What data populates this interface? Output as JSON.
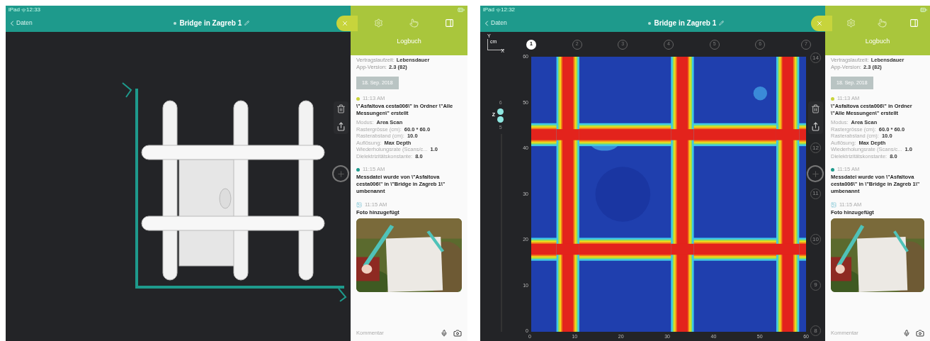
{
  "screens": [
    {
      "kind": "model-3d",
      "status_bar": {
        "carrier": "iPad",
        "time": "12:33"
      },
      "nav": {
        "back": "Daten",
        "title": "Bridge in Zagreb 1"
      },
      "logbook": {
        "header": "Logbuch",
        "info": [
          {
            "label": "Vertragslaufzeit:",
            "value": "Lebensdauer"
          },
          {
            "label": "App-Version:",
            "value": "2.3 (82)"
          }
        ],
        "date": "18. Sep. 2018",
        "entries": [
          {
            "kind": "event",
            "color": "#c9d43a",
            "time": "11:13 AM",
            "title": "\\\"Asfaltova cesta006\\\" in Ordner \\\"Alle Messungen\\\" erstellt",
            "details": [
              {
                "label": "Modus:",
                "value": "Area Scan"
              },
              {
                "label": "Rastergrösse (cm):",
                "value": "60.0 * 60.0"
              },
              {
                "label": "Rasterabstand (cm):",
                "value": "10.0"
              },
              {
                "label": "Auflösung:",
                "value": "Max Depth"
              },
              {
                "label": "Wiederholungsrate (Scans/c...",
                "value": "1.0"
              },
              {
                "label": "Dielektrizitätskonstante:",
                "value": "8.0"
              }
            ]
          },
          {
            "kind": "event",
            "color": "#1e9a8c",
            "time": "11:15 AM",
            "title": "Messdatei wurde von \\\"Asfaltova cesta006\\\" in \\\"Bridge in Zagreb 1\\\" umbenannt"
          },
          {
            "time": "11:15 AM",
            "title": "Foto hinzugefügt"
          }
        ],
        "comment_placeholder": "Kommentar"
      }
    },
    {
      "kind": "heatmap",
      "status_bar": {
        "carrier": "iPad",
        "time": "12:32"
      },
      "nav": {
        "back": "Daten",
        "title": "Bridge in Zagreb 1"
      },
      "heatmap": {
        "axis_y": "Y",
        "unit": "cm",
        "axis_x": "X",
        "depth_label": "Z",
        "depth_levels": [
          "6",
          "5"
        ],
        "x_ticks": [
          "0",
          "10",
          "20",
          "30",
          "40",
          "50",
          "60"
        ],
        "y_ticks": [
          "60",
          "50",
          "40",
          "30",
          "20",
          "10",
          "0"
        ],
        "top_lines": [
          {
            "label": "1",
            "selected": true
          },
          {
            "label": "2",
            "selected": false
          },
          {
            "label": "3",
            "selected": false
          },
          {
            "label": "4",
            "selected": false
          },
          {
            "label": "5",
            "selected": false
          },
          {
            "label": "6",
            "selected": false
          },
          {
            "label": "7",
            "selected": false
          }
        ],
        "right_lines": [
          "14",
          "12",
          "11",
          "10",
          "9",
          "8"
        ]
      },
      "logbook": {
        "header": "Logbuch",
        "info": [
          {
            "label": "Vertragslaufzeit:",
            "value": "Lebensdauer"
          },
          {
            "label": "App-Version:",
            "value": "2.3 (82)"
          }
        ],
        "date": "18. Sep. 2018",
        "entries": [
          {
            "kind": "event",
            "color": "#c9d43a",
            "time": "11:13 AM",
            "title": "\\\"Asfaltova cesta006\\\" in Ordner \\\"Alle Messungen\\\" erstellt",
            "details": [
              {
                "label": "Modus:",
                "value": "Area Scan"
              },
              {
                "label": "Rastergrösse (cm):",
                "value": "60.0 * 60.0"
              },
              {
                "label": "Rasterabstand (cm):",
                "value": "10.0"
              },
              {
                "label": "Auflösung:",
                "value": "Max Depth"
              },
              {
                "label": "Wiederholungsrate (Scans/c...",
                "value": "1.0"
              },
              {
                "label": "Dielektrizitätskonstante:",
                "value": "8.0"
              }
            ]
          },
          {
            "kind": "event",
            "color": "#1e9a8c",
            "time": "11:15 AM",
            "title": "Messdatei wurde von \\\"Asfaltova cesta006\\\" in \\\"Bridge in Zagreb 1\\\" umbenannt"
          },
          {
            "time": "11:15 AM",
            "title": "Foto hinzugefügt"
          }
        ],
        "comment_placeholder": "Kommentar"
      }
    }
  ]
}
